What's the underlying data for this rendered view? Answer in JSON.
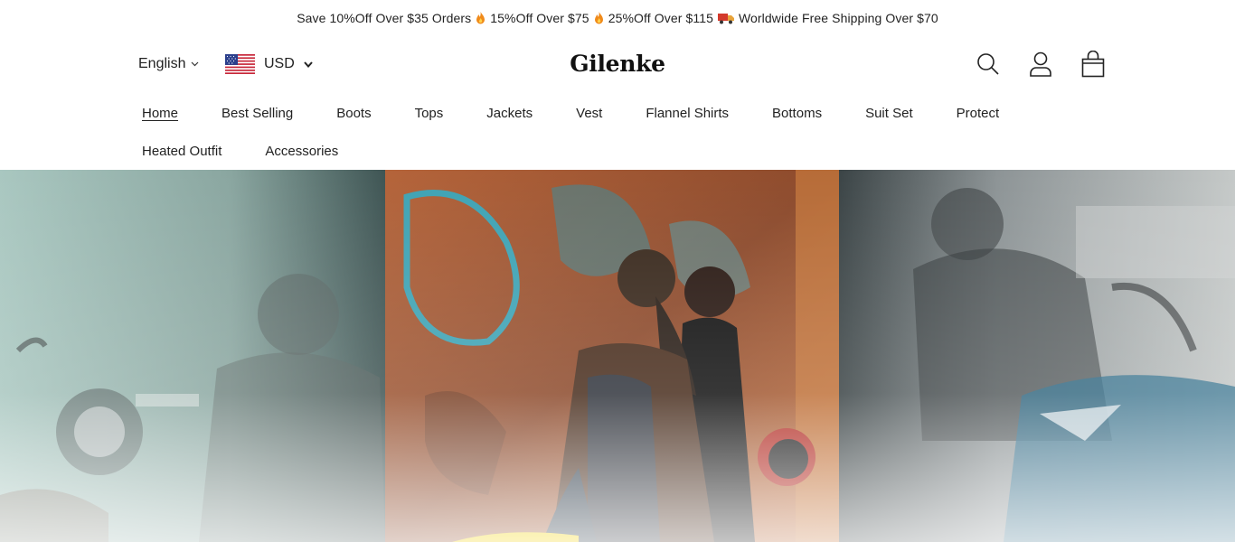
{
  "announcement": {
    "part1": "Save 10%Off Over $35 Orders",
    "part2": "15%Off Over $75",
    "part3": "25%Off Over $115",
    "part4": "Worldwide Free Shipping Over $70"
  },
  "header": {
    "language": "English",
    "currency": "USD",
    "logo": "Gilenke"
  },
  "nav": {
    "row1": [
      "Home",
      "Best Selling",
      "Boots",
      "Tops",
      "Jackets",
      "Vest",
      "Flannel Shirts",
      "Bottoms",
      "Suit Set",
      "Protect"
    ],
    "row2": [
      "Heated Outfit",
      "Accessories"
    ],
    "active": "Home"
  },
  "icons": [
    "search-icon",
    "account-icon",
    "cart-icon",
    "fire-icon",
    "truck-icon",
    "us-flag-icon",
    "chevron-down-icon"
  ],
  "colors": {
    "text": "#222222",
    "background": "#ffffff",
    "fire": "#f08a1a",
    "truck": "#d33a2c"
  }
}
